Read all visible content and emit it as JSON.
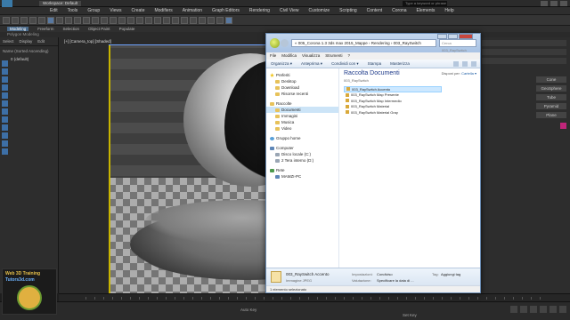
{
  "max": {
    "workspace": "Workspace: Default",
    "search_placeholder": "Type a keyword or phrase",
    "menu": [
      "Edit",
      "Tools",
      "Group",
      "Views",
      "Create",
      "Modifiers",
      "Animation",
      "Graph Editors",
      "Rendering",
      "Civil View",
      "Customize",
      "Scripting",
      "Content",
      "Corona",
      "Elements",
      "Help"
    ],
    "ribbon_tabs": [
      "Modeling",
      "Freeform",
      "Selection",
      "Object Paint",
      "Populate"
    ],
    "ribbon_sub": "Polygon Modeling",
    "scene_tabs": [
      "Select",
      "Display",
      "Edit"
    ],
    "scene_header": "Name (Sorted Ascending)",
    "scene_object": "0 (default)",
    "viewport_label": "[+] [Camera_top] [Shaded]",
    "cmd_buttons": [
      "Cone",
      "GeoSphere",
      "Tube",
      "Pyramid",
      "Plane"
    ],
    "status_autokey": "Auto Key",
    "status_setkey": "Set Key",
    "accent": "#c0257a"
  },
  "brand": {
    "line1": "Web 3D Training",
    "line2": "Tutors3d.com"
  },
  "explorer": {
    "address": "« 005_Corona 1.3 3ds max 2015_Mappe › Rendering › 003_RaySwitch",
    "search_placeholder": "Cerca 003_RaySwitch",
    "menu": [
      "File",
      "Modifica",
      "Visualizza",
      "Strumenti",
      "?"
    ],
    "cmd": [
      "Organizza ▾",
      "Anteprima ▾",
      "Condividi con ▾",
      "Stampa",
      "Masterizza"
    ],
    "nav": {
      "favorites": "Preferiti",
      "favorites_items": [
        "Desktop",
        "Download",
        "Risorse recenti"
      ],
      "libraries": "Raccolte",
      "libraries_items": [
        "Documenti",
        "Immagini",
        "Musica",
        "Video"
      ],
      "homegroup": "Gruppo home",
      "computer": "Computer",
      "computer_items": [
        "Disco locale (C:)",
        "2 Tera interno (D:)"
      ],
      "network": "Rete",
      "network_items": [
        "MAMZI-PC"
      ]
    },
    "library_title": "Raccolta Documenti",
    "library_subtitle": "003_RaySwitch",
    "arrange_label": "Disponi per:",
    "arrange_value": "Cartella ▾",
    "files": [
      "003_RaySwitch Accento",
      "003_RaySwitch Map Presente",
      "003_RaySwitch Map Intermedio",
      "003_RaySwitch Material",
      "003_RaySwitch Material Gray"
    ],
    "details": {
      "name": "003_RaySwitch Accento",
      "type": "Immagine JPEG",
      "k1": "Impostazioni:",
      "v1": "Condiviso",
      "k2": "Valutazione:",
      "v2": "Specificare la data di ...",
      "k3": "Tag:",
      "v3": "Aggiungi tag"
    },
    "status": "1 elemento selezionato"
  }
}
